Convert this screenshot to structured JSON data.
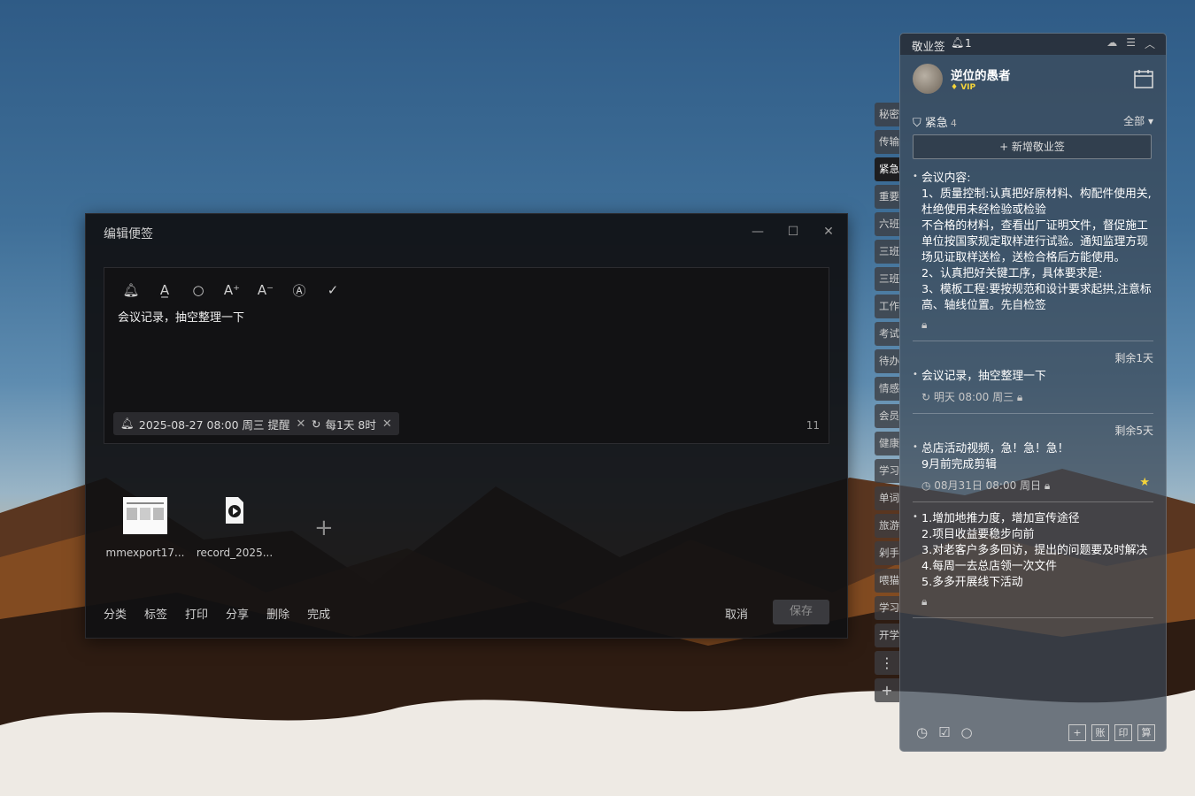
{
  "editor": {
    "title": "编辑便签",
    "window_controls": [
      "—",
      "☐",
      "✕"
    ],
    "toolbar_icons": [
      "bell-icon",
      "text-color-icon",
      "search-icon",
      "font-increase-icon",
      "font-decrease-icon",
      "format-icon",
      "check-icon"
    ],
    "toolbar_glyphs": [
      "🔔︎",
      "A̲",
      "○",
      "A⁺",
      "A⁻",
      "Ⓐ",
      "✓"
    ],
    "note_text": "会议记录，抽空整理一下",
    "reminder_chip": "2025-08-27 08:00 周三 提醒",
    "repeat_chip": "每1天 8时",
    "char_count": "11",
    "attachments": [
      {
        "name": "mmexport17..."
      },
      {
        "name": "record_2025..."
      }
    ],
    "add_attachment": "+",
    "bottom_actions": [
      "分类",
      "标签",
      "打印",
      "分享",
      "删除",
      "完成"
    ],
    "cancel_label": "取消",
    "save_label": "保存"
  },
  "side_tabs": [
    "秘密",
    "传输",
    "紧急",
    "重要",
    "六班",
    "三班",
    "三班",
    "工作",
    "考试",
    "待办",
    "情感",
    "会员",
    "健康",
    "学习",
    "单词",
    "旅游",
    "剁手",
    "喂猫",
    "学习",
    "开学",
    "⋮",
    "+"
  ],
  "panel": {
    "app_name": "敬业签",
    "notification_count": "1",
    "username": "逆位的愚者",
    "vip_label": "VIP",
    "category": "紧急",
    "category_count": "4",
    "filter_label": "全部 ▾",
    "new_note_label": "+ 新增敬业签",
    "notes": [
      {
        "remain": "",
        "body": "会议内容:\n1、质量控制:认真把好原材料、构配件使用关,杜绝使用未经检验或检验\n不合格的材料，查看出厂证明文件，督促施工单位按国家规定取样进行试验。通知监理方现场见证取样送检，送检合格后方能使用。\n2、认真把好关键工序，具体要求是:\n3、模板工程:要按规范和设计要求起拱,注意标高、轴线位置。先自检签",
        "meta": "🔒︎",
        "star": ""
      },
      {
        "remain": "剩余1天",
        "body": "会议记录，抽空整理一下",
        "meta": "↻ 明天 08:00 周三 🔒︎",
        "star": ""
      },
      {
        "remain": "剩余5天",
        "body": "总店活动视频，急！急！急！\n9月前完成剪辑",
        "meta": "◷ 08月31日 08:00 周日 🔒︎",
        "star": "★"
      },
      {
        "remain": "",
        "body": "1.增加地推力度，增加宣传途径\n2.项目收益要稳步向前\n3.对老客户多多回访，提出的问题要及时解决\n4.每周一去总店领一次文件\n5.多多开展线下活动",
        "meta": "🔒︎",
        "star": ""
      }
    ],
    "bottom_left_icons": [
      "clock-icon",
      "checklist-icon",
      "search-icon"
    ],
    "bottom_left_glyphs": [
      "◷",
      "☑",
      "○"
    ],
    "bottom_right_labels": [
      "+",
      "账",
      "印",
      "算"
    ]
  }
}
